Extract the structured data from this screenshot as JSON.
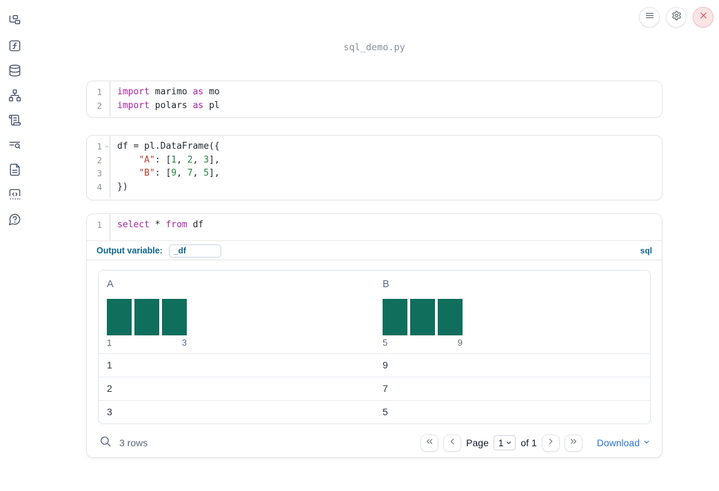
{
  "notebook": {
    "filename": "sql_demo.py"
  },
  "topbar": {
    "menu_button": "menu",
    "settings_button": "settings",
    "close_button": "close"
  },
  "sidebar": {
    "items": [
      {
        "name": "file-explorer"
      },
      {
        "name": "variables"
      },
      {
        "name": "data-sources"
      },
      {
        "name": "dependency-graph"
      },
      {
        "name": "logs"
      },
      {
        "name": "outline-search"
      },
      {
        "name": "documentation"
      },
      {
        "name": "snippets"
      },
      {
        "name": "help"
      }
    ]
  },
  "cells": [
    {
      "id": "imports",
      "lines": [
        [
          [
            "kw",
            "import"
          ],
          [
            "pl",
            " marimo "
          ],
          [
            "kw",
            "as"
          ],
          [
            "pl",
            " mo"
          ]
        ],
        [
          [
            "kw",
            "import"
          ],
          [
            "pl",
            " polars "
          ],
          [
            "kw",
            "as"
          ],
          [
            "pl",
            " pl"
          ]
        ]
      ]
    },
    {
      "id": "dataframe",
      "fold_line": 1,
      "lines": [
        [
          [
            "pl",
            "df = pl.DataFrame({"
          ]
        ],
        [
          [
            "pl",
            "    "
          ],
          [
            "str",
            "\"A\""
          ],
          [
            "pl",
            ": ["
          ],
          [
            "num",
            "1"
          ],
          [
            "pl",
            ", "
          ],
          [
            "num",
            "2"
          ],
          [
            "pl",
            ", "
          ],
          [
            "num",
            "3"
          ],
          [
            "pl",
            "],"
          ]
        ],
        [
          [
            "pl",
            "    "
          ],
          [
            "str",
            "\"B\""
          ],
          [
            "pl",
            ": ["
          ],
          [
            "num",
            "9"
          ],
          [
            "pl",
            ", "
          ],
          [
            "num",
            "7"
          ],
          [
            "pl",
            ", "
          ],
          [
            "num",
            "5"
          ],
          [
            "pl",
            "],"
          ]
        ],
        [
          [
            "pl",
            "})"
          ]
        ]
      ]
    },
    {
      "id": "sql",
      "lines": [
        [
          [
            "kw",
            "select"
          ],
          [
            "pl",
            " * "
          ],
          [
            "kw",
            "from"
          ],
          [
            "pl",
            " df"
          ]
        ]
      ]
    }
  ],
  "sql_panel": {
    "output_variable_label": "Output variable:",
    "output_variable_value": "_df",
    "language_badge": "sql"
  },
  "data_table": {
    "columns": [
      {
        "name": "A",
        "histogram": {
          "bar_count": 3,
          "min_label": "1",
          "max_label": "3"
        }
      },
      {
        "name": "B",
        "histogram": {
          "bar_count": 3,
          "min_label": "5",
          "max_label": "9"
        }
      }
    ],
    "rows": [
      [
        "1",
        "9"
      ],
      [
        "2",
        "7"
      ],
      [
        "3",
        "5"
      ]
    ],
    "footer": {
      "row_count": "3 rows",
      "page_label": "Page",
      "page_value": "1",
      "of_label": "of 1",
      "download_label": "Download"
    }
  },
  "colors": {
    "keyword": "#a626a4",
    "string": "#b03d2e",
    "number": "#22863a",
    "histogram_bar": "#0f6e5c",
    "accent_blue": "#10648c",
    "link_blue": "#2e74cc",
    "close_red": "#d64545"
  }
}
